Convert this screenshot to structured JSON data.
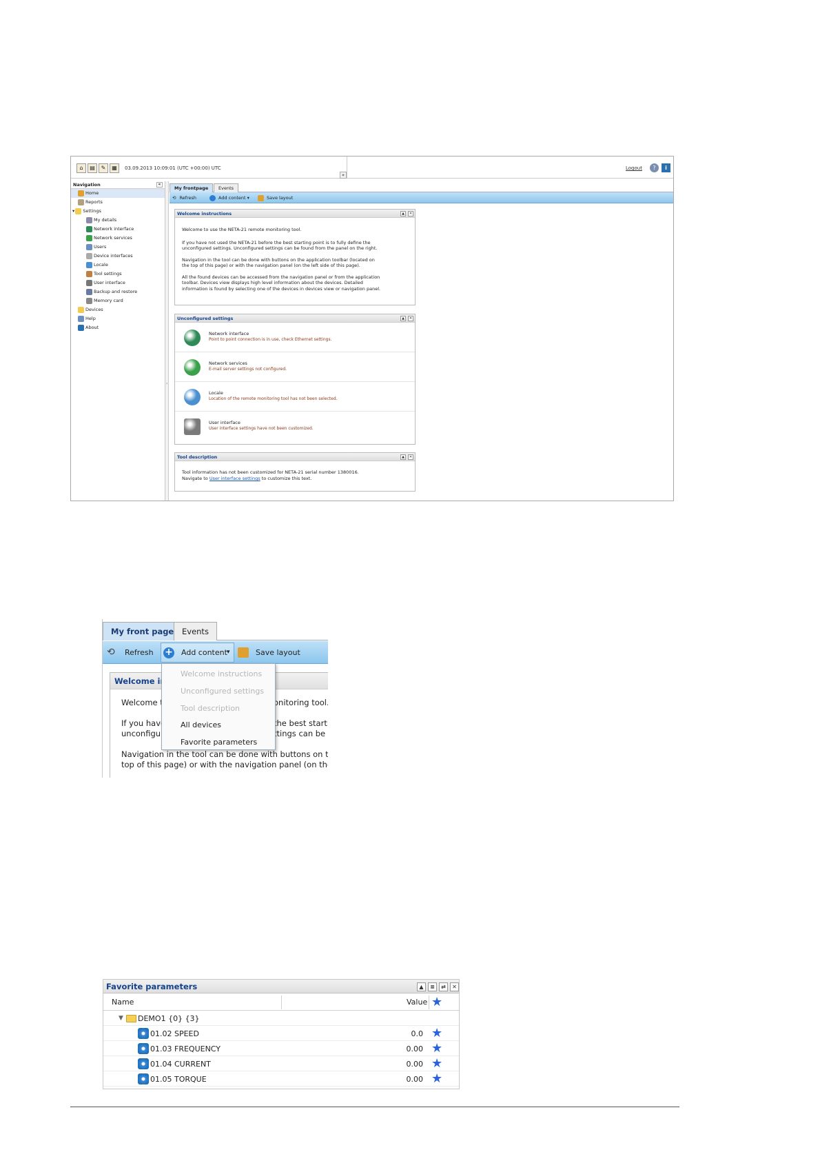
{
  "shot1": {
    "topbar": {
      "datetime": "03.09.2013 10:09:01 (UTC +00:00) UTC",
      "logout": "Logout",
      "collapse_glyph": "»",
      "help_glyph": "?",
      "info_glyph": "i"
    },
    "nav": {
      "title": "Navigation",
      "collapse_glyph": "«",
      "items": [
        {
          "label": "Home",
          "icon": "home-icon",
          "color": "#e0a030"
        },
        {
          "label": "Reports",
          "icon": "reports-icon",
          "color": "#b0a080"
        },
        {
          "label": "Settings",
          "icon": "folder-icon",
          "color": "#f3cc4f"
        },
        {
          "label": "My details",
          "icon": "user-icon",
          "color": "#8a8aaa"
        },
        {
          "label": "Network interface",
          "icon": "network-icon",
          "color": "#2e8b57"
        },
        {
          "label": "Network services",
          "icon": "services-icon",
          "color": "#3aa04a"
        },
        {
          "label": "Users",
          "icon": "users-icon",
          "color": "#6a8fc0"
        },
        {
          "label": "Device interfaces",
          "icon": "device-icon",
          "color": "#aaaaaa"
        },
        {
          "label": "Locale",
          "icon": "globe-icon",
          "color": "#4a90d0"
        },
        {
          "label": "Tool settings",
          "icon": "tool-icon",
          "color": "#c08040"
        },
        {
          "label": "User interface",
          "icon": "ui-icon",
          "color": "#777777"
        },
        {
          "label": "Backup and restore",
          "icon": "backup-icon",
          "color": "#6a7aa0"
        },
        {
          "label": "Memory card",
          "icon": "memory-icon",
          "color": "#888888"
        },
        {
          "label": "Devices",
          "icon": "folder-icon",
          "color": "#f3cc4f"
        },
        {
          "label": "Help",
          "icon": "help-icon",
          "color": "#6a8fc0"
        },
        {
          "label": "About",
          "icon": "info-icon",
          "color": "#2a6fb0"
        }
      ]
    },
    "tabs": [
      "My frontpage",
      "Events"
    ],
    "toolbar": {
      "refresh": "Refresh",
      "add_content": "Add content",
      "save_layout": "Save layout"
    },
    "welcome": {
      "title": "Welcome instructions",
      "lines": [
        "Welcome to use the NETA-21 remote monitoring tool.",
        "If you have not used the NETA-21 before the best starting point is to fully define the",
        "unconfigured settings. Unconfigured settings can be found from the panel on the right.",
        "Navigation in the tool can be done with buttons on the application toolbar (located on",
        "the top of this page) or with the navigation panel (on the left side of this page).",
        "All the found devices can be accessed from the navigation panel or from the application",
        "toolbar. Devices view displays high level information about the devices. Detailed",
        "information is found by selecting one of the devices in devices view or navigation panel."
      ]
    },
    "unconfigured": {
      "title": "Unconfigured settings",
      "items": [
        {
          "title": "Network interface",
          "desc": "Point to point connection is in use, check Ethernet settings.",
          "icon": "network-interface-icon",
          "color": "#2e8b57"
        },
        {
          "title": "Network services",
          "desc": "E-mail server settings not configured.",
          "icon": "network-services-icon",
          "color": "#3aa04a"
        },
        {
          "title": "Locale",
          "desc": "Location of the remote monitoring tool has not been selected.",
          "icon": "locale-globe-icon",
          "color": "#4a90d0"
        },
        {
          "title": "User interface",
          "desc": "User interface settings have not been customized.",
          "icon": "user-interface-icon",
          "color": "#7a7a7a"
        }
      ]
    },
    "tool_description": {
      "title": "Tool description",
      "line1": "Tool information has not been customized for NETA-21 serial number 1380016.",
      "line2_pre": "Navigate to ",
      "line2_link": "User interface settings",
      "line2_post": " to customize this text."
    }
  },
  "shot2": {
    "tabs": [
      "My front page",
      "Events"
    ],
    "toolbar": {
      "refresh": "Refresh",
      "add_content": "Add content",
      "save_layout": "Save layout",
      "dropdown_glyph": "▾"
    },
    "panel_title": "Welcome in",
    "text_lines": [
      "Welcome t",
      "If you have",
      "unconfigu",
      "Navigation in the tool can be done with buttons on the",
      "top of this page) or with the navigation panel (on the le"
    ],
    "text_right": [
      "onitoring tool.",
      "the best starti",
      "ttings can be f"
    ],
    "dropdown": {
      "disabled": [
        "Welcome instructions",
        "Unconfigured settings",
        "Tool description"
      ],
      "enabled": [
        "All devices",
        "Favorite parameters"
      ]
    }
  },
  "shot3": {
    "title": "Favorite parameters",
    "columns": {
      "name": "Name",
      "value": "Value"
    },
    "group": "DEMO1 {0} {3}",
    "rows": [
      {
        "name": "01.02 SPEED",
        "value": "0.0"
      },
      {
        "name": "01.03 FREQUENCY",
        "value": "0.00"
      },
      {
        "name": "01.04 CURRENT",
        "value": "0.00"
      },
      {
        "name": "01.05 TORQUE",
        "value": "0.00"
      }
    ],
    "star_color": "#2a63d9"
  }
}
